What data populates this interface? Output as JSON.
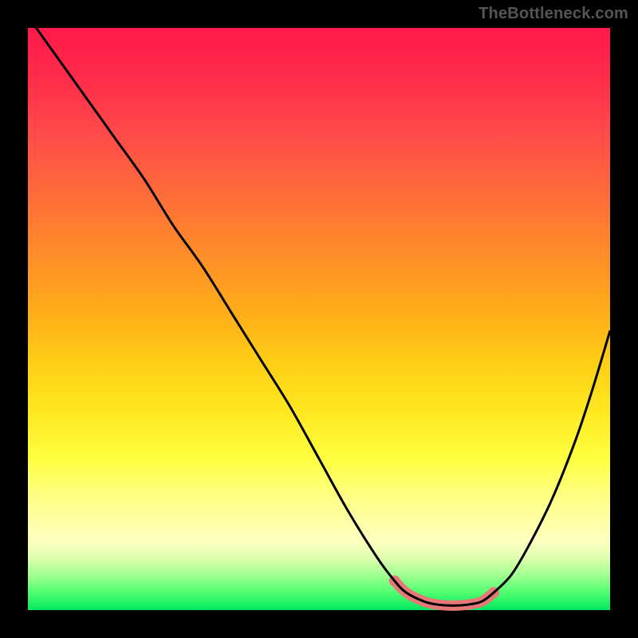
{
  "watermark": "TheBottleneck.com",
  "chart_data": {
    "type": "line",
    "title": "",
    "xlabel": "",
    "ylabel": "",
    "xlim": [
      0,
      100
    ],
    "ylim": [
      0,
      100
    ],
    "series": [
      {
        "name": "bottleneck-curve",
        "x": [
          0,
          5,
          10,
          15,
          20,
          25,
          30,
          35,
          40,
          45,
          50,
          55,
          60,
          63,
          65,
          68,
          70,
          72,
          74,
          76,
          78,
          80,
          83,
          86,
          90,
          94,
          97,
          100
        ],
        "values": [
          102,
          95,
          88,
          81,
          74,
          66,
          59,
          51,
          43,
          35,
          26,
          17,
          9,
          5,
          3,
          1.5,
          1,
          0.8,
          0.8,
          1,
          1.5,
          3,
          6,
          11,
          19,
          29,
          38,
          48
        ]
      }
    ],
    "highlight": {
      "name": "optimal-range",
      "x_start": 63,
      "x_end": 80,
      "color": "#e87878"
    },
    "background_gradient": [
      "#ff1a4a",
      "#ffd015",
      "#ffff40",
      "#00e860"
    ]
  }
}
